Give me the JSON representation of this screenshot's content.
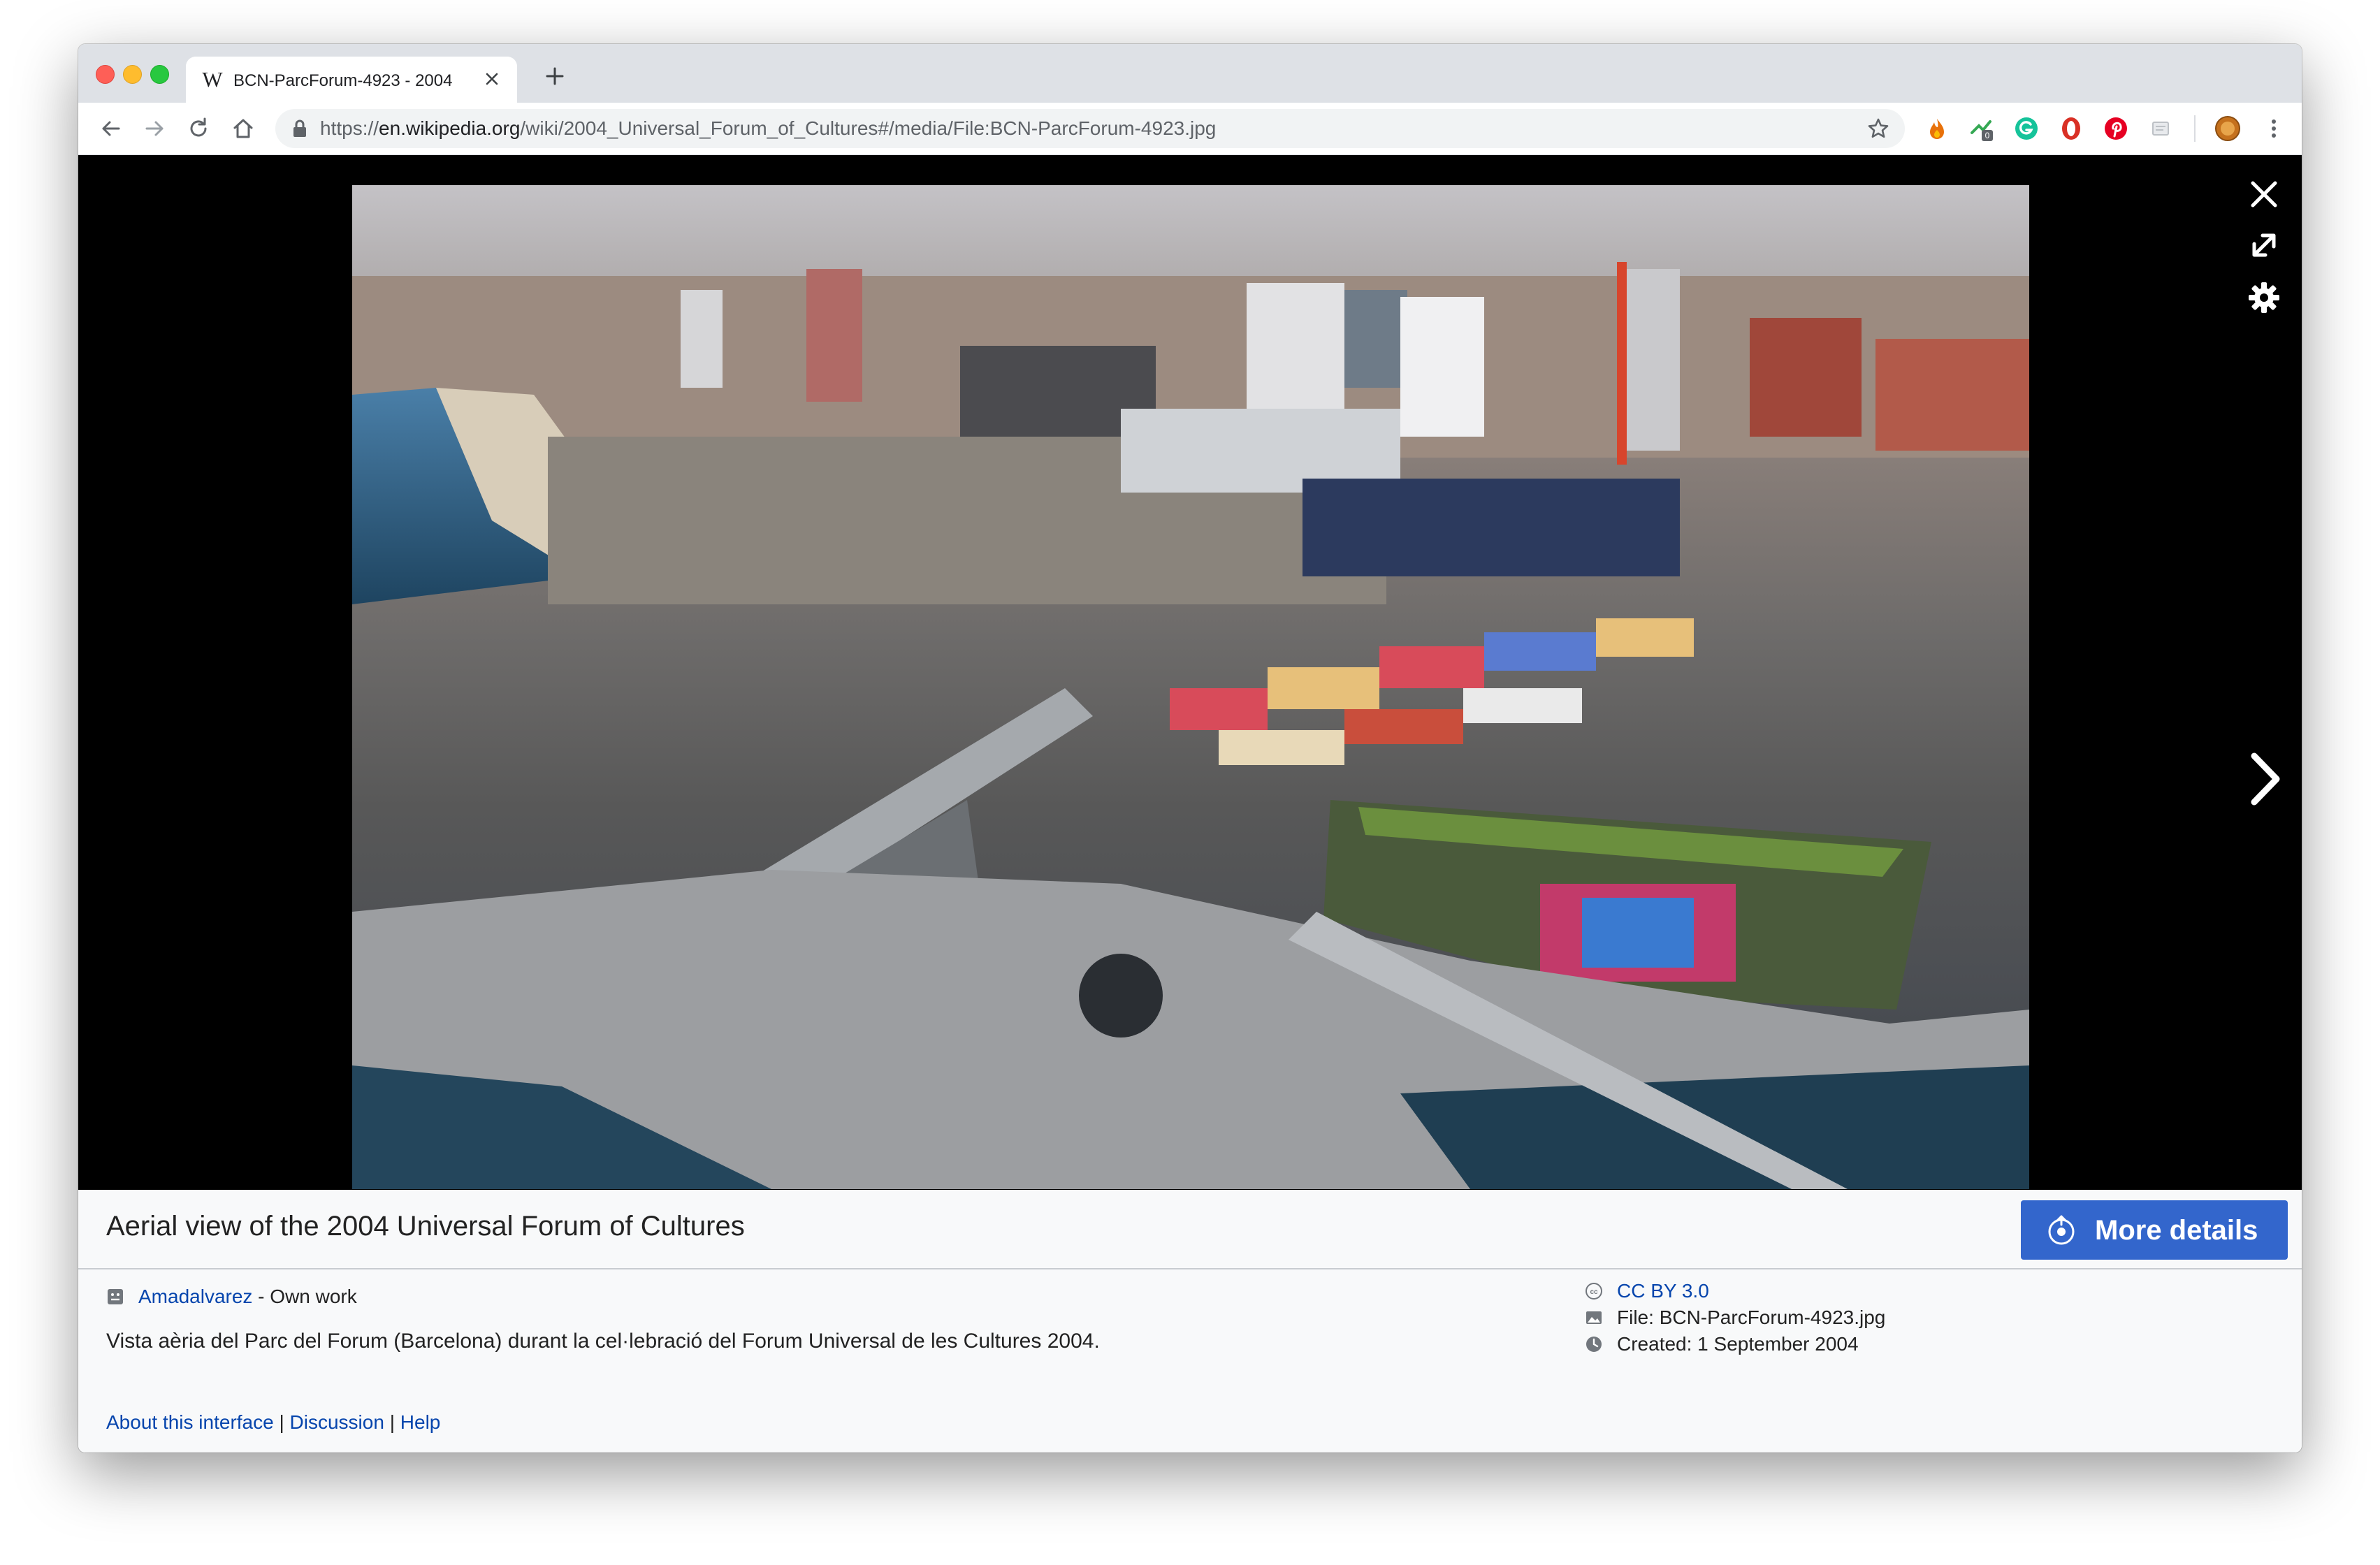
{
  "browser": {
    "tab": {
      "favicon": "W",
      "title": "BCN-ParcForum-4923 - 2004"
    },
    "address_bar": {
      "url_scheme": "https://",
      "url_host": "en.wikipedia.org",
      "url_path": "/wiki/2004_Universal_Forum_of_Cultures#/media/File:BCN-ParcForum-4923.jpg"
    },
    "extensions": [
      {
        "name": "fire-extension-icon",
        "color": "#e8710a"
      },
      {
        "name": "green-extension-icon",
        "color": "#34a853",
        "badge": "0"
      },
      {
        "name": "grammarly-extension-icon",
        "color": "#15c39a"
      },
      {
        "name": "red-extension-icon",
        "color": "#d93025"
      },
      {
        "name": "pinterest-extension-icon",
        "color": "#e60023"
      },
      {
        "name": "grey-extension-icon",
        "color": "#bdc1c6"
      },
      {
        "name": "profile-avatar",
        "color": "#c5711d"
      }
    ]
  },
  "viewer": {
    "image_alt": "Aerial view of the 2004 Universal Forum of Cultures",
    "controls": [
      "close-icon",
      "fullscreen-icon",
      "settings-gear-icon",
      "next-image-icon"
    ]
  },
  "metadata": {
    "caption": "Aerial view of the 2004 Universal Forum of Cultures",
    "more_details_label": "More details",
    "author": "Amadalvarez",
    "author_suffix": " - Own work",
    "description": "Vista aèria del Parc del Forum (Barcelona) durant la cel·lebració del Forum Universal de les Cultures 2004.",
    "license": "CC BY 3.0",
    "file_label": "File: ",
    "file_name": "BCN-ParcForum-4923.jpg",
    "created_label": "Created: ",
    "created_date": "1 September 2004",
    "footer_links": {
      "about": "About this interface",
      "separator": " | ",
      "discussion": "Discussion",
      "help": "Help"
    }
  },
  "colors": {
    "accent": "#3366cc",
    "link": "#0645ad",
    "viewer_bg": "#000000"
  }
}
